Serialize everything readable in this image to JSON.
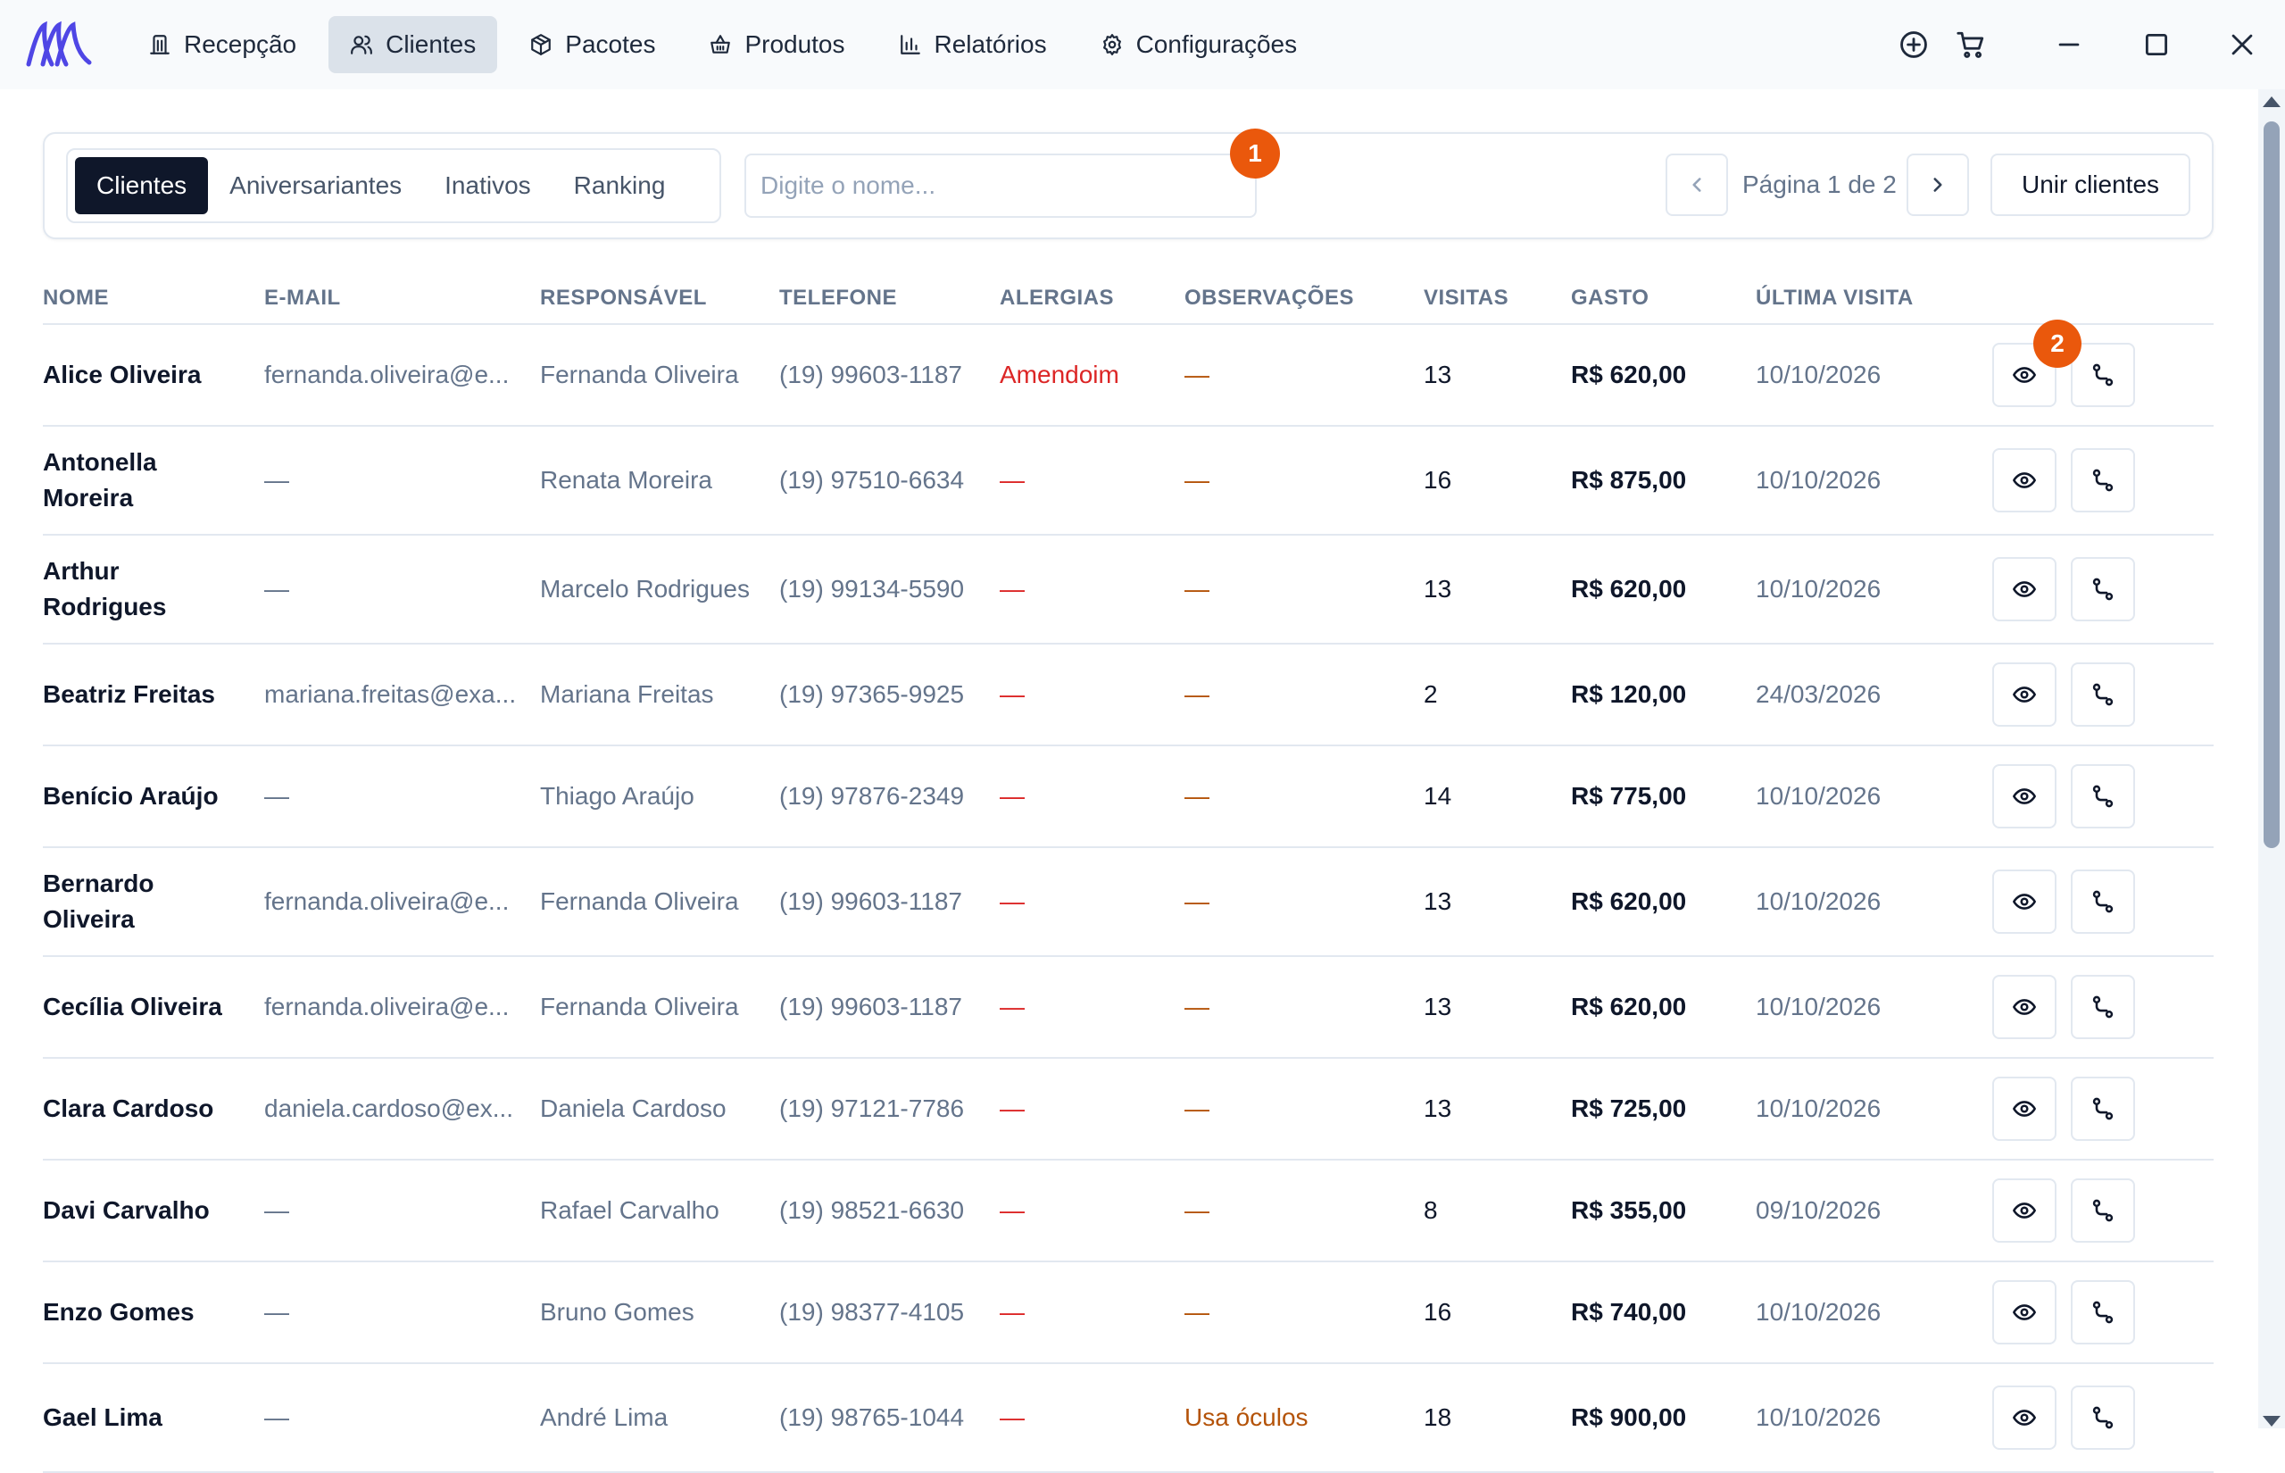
{
  "nav": {
    "items": [
      {
        "label": "Recepção",
        "icon": "reception-icon"
      },
      {
        "label": "Clientes",
        "icon": "users-icon"
      },
      {
        "label": "Pacotes",
        "icon": "package-icon"
      },
      {
        "label": "Produtos",
        "icon": "basket-icon"
      },
      {
        "label": "Relatórios",
        "icon": "bar-chart-icon"
      },
      {
        "label": "Configurações",
        "icon": "gear-icon"
      }
    ],
    "active": "Clientes"
  },
  "tabs": [
    "Clientes",
    "Aniversariantes",
    "Inativos",
    "Ranking"
  ],
  "search": {
    "placeholder": "Digite o nome...",
    "value": ""
  },
  "badges": {
    "first": "1",
    "second": "2"
  },
  "pagination": {
    "label": "Página 1 de 2"
  },
  "merge_label": "Unir clientes",
  "columns": [
    "NOME",
    "E-MAIL",
    "RESPONSÁVEL",
    "TELEFONE",
    "ALERGIAS",
    "OBSERVAÇÕES",
    "VISITAS",
    "GASTO",
    "ÚLTIMA VISITA"
  ],
  "rows": [
    {
      "name": "Alice Oliveira",
      "email": "fernanda.oliveira@e...",
      "responsible": "Fernanda Oliveira",
      "phone": "(19) 99603-1187",
      "allergies": "Amendoim",
      "notes": "—",
      "visits": "13",
      "spent": "R$ 620,00",
      "last_visit": "10/10/2026"
    },
    {
      "name": "Antonella Moreira",
      "email": "—",
      "responsible": "Renata Moreira",
      "phone": "(19) 97510-6634",
      "allergies": "—",
      "notes": "—",
      "visits": "16",
      "spent": "R$ 875,00",
      "last_visit": "10/10/2026"
    },
    {
      "name": "Arthur Rodrigues",
      "email": "—",
      "responsible": "Marcelo Rodrigues",
      "phone": "(19) 99134-5590",
      "allergies": "—",
      "notes": "—",
      "visits": "13",
      "spent": "R$ 620,00",
      "last_visit": "10/10/2026"
    },
    {
      "name": "Beatriz Freitas",
      "email": "mariana.freitas@exa...",
      "responsible": "Mariana Freitas",
      "phone": "(19) 97365-9925",
      "allergies": "—",
      "notes": "—",
      "visits": "2",
      "spent": "R$ 120,00",
      "last_visit": "24/03/2026"
    },
    {
      "name": "Benício Araújo",
      "email": "—",
      "responsible": "Thiago Araújo",
      "phone": "(19) 97876-2349",
      "allergies": "—",
      "notes": "—",
      "visits": "14",
      "spent": "R$ 775,00",
      "last_visit": "10/10/2026"
    },
    {
      "name": "Bernardo Oliveira",
      "email": "fernanda.oliveira@e...",
      "responsible": "Fernanda Oliveira",
      "phone": "(19) 99603-1187",
      "allergies": "—",
      "notes": "—",
      "visits": "13",
      "spent": "R$ 620,00",
      "last_visit": "10/10/2026"
    },
    {
      "name": "Cecília Oliveira",
      "email": "fernanda.oliveira@e...",
      "responsible": "Fernanda Oliveira",
      "phone": "(19) 99603-1187",
      "allergies": "—",
      "notes": "—",
      "visits": "13",
      "spent": "R$ 620,00",
      "last_visit": "10/10/2026"
    },
    {
      "name": "Clara Cardoso",
      "email": "daniela.cardoso@ex...",
      "responsible": "Daniela Cardoso",
      "phone": "(19) 97121-7786",
      "allergies": "—",
      "notes": "—",
      "visits": "13",
      "spent": "R$ 725,00",
      "last_visit": "10/10/2026"
    },
    {
      "name": "Davi Carvalho",
      "email": "—",
      "responsible": "Rafael Carvalho",
      "phone": "(19) 98521-6630",
      "allergies": "—",
      "notes": "—",
      "visits": "8",
      "spent": "R$ 355,00",
      "last_visit": "09/10/2026"
    },
    {
      "name": "Enzo Gomes",
      "email": "—",
      "responsible": "Bruno Gomes",
      "phone": "(19) 98377-4105",
      "allergies": "—",
      "notes": "—",
      "visits": "16",
      "spent": "R$ 740,00",
      "last_visit": "10/10/2026"
    },
    {
      "name": "Gael Lima",
      "email": "—",
      "responsible": "André Lima",
      "phone": "(19) 98765-1044",
      "allergies": "—",
      "notes": "Usa óculos",
      "visits": "18",
      "spent": "R$ 900,00",
      "last_visit": "10/10/2026"
    }
  ],
  "colors": {
    "accent": "#0f172a",
    "badge": "#ea580c",
    "allergy": "#dc2626",
    "notes": "#b45309"
  }
}
